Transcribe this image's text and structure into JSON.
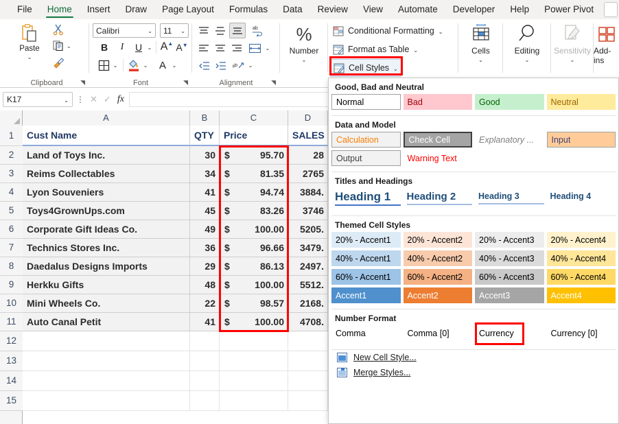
{
  "ribbon_tabs": [
    {
      "label": "File",
      "active": false
    },
    {
      "label": "Home",
      "active": true
    },
    {
      "label": "Insert",
      "active": false
    },
    {
      "label": "Draw",
      "active": false
    },
    {
      "label": "Page Layout",
      "active": false
    },
    {
      "label": "Formulas",
      "active": false
    },
    {
      "label": "Data",
      "active": false
    },
    {
      "label": "Review",
      "active": false
    },
    {
      "label": "View",
      "active": false
    },
    {
      "label": "Automate",
      "active": false
    },
    {
      "label": "Developer",
      "active": false
    },
    {
      "label": "Help",
      "active": false
    },
    {
      "label": "Power Pivot",
      "active": false
    }
  ],
  "ribbon": {
    "clipboard": {
      "group_label": "Clipboard",
      "paste_label": "Paste",
      "cut_name": "cut-icon",
      "copy_name": "copy-icon",
      "format_painter_name": "format-painter-icon"
    },
    "font": {
      "group_label": "Font",
      "font_name": "Calibri",
      "font_size": "11",
      "bold": "B",
      "italic": "I",
      "underline": "U",
      "grow_font": "A",
      "shrink_font": "A",
      "borders_name": "borders-icon",
      "fill_color_name": "fill-color-icon",
      "font_color_name": "font-color-icon"
    },
    "alignment": {
      "group_label": "Alignment",
      "wrap_text_name": "wrap-text-icon",
      "merge_center_name": "merge-and-center-icon",
      "orientation_name": "orientation-icon",
      "decrease_indent_name": "decrease-indent-icon",
      "increase_indent_name": "increase-indent-icon"
    },
    "number": {
      "group_label": "Number",
      "label": "Number",
      "symbol": "%"
    },
    "styles": {
      "conditional_formatting": "Conditional Formatting",
      "format_as_table": "Format as Table",
      "cell_styles": "Cell Styles",
      "chevron": "⌄"
    },
    "cells": {
      "label": "Cells"
    },
    "editing": {
      "label": "Editing"
    },
    "sensitivity": {
      "label": "Sensitivity"
    },
    "addins": {
      "label": "Add-ins"
    }
  },
  "formula_bar": {
    "name_box": "K17",
    "formula_value": "",
    "cancel_icon": "cancel-icon",
    "confirm_icon": "confirm-icon",
    "fx_label": "fx"
  },
  "sheet": {
    "column_headers": [
      "A",
      "B",
      "C",
      "D"
    ],
    "row_numbers": [
      "1",
      "2",
      "3",
      "4",
      "5",
      "6",
      "7",
      "8",
      "9",
      "10",
      "11",
      "12",
      "13",
      "14",
      "15"
    ],
    "headers": {
      "a": "Cust Name",
      "b": "QTY",
      "c": "Price",
      "d": "SALES"
    },
    "rows": [
      {
        "row": "2",
        "name": "Land of Toys Inc.",
        "qty": "30",
        "price_sym": "$",
        "price": "95.70",
        "sales": "28"
      },
      {
        "row": "3",
        "name": "Reims Collectables",
        "qty": "34",
        "price_sym": "$",
        "price": "81.35",
        "sales": "2765"
      },
      {
        "row": "4",
        "name": "Lyon Souveniers",
        "qty": "41",
        "price_sym": "$",
        "price": "94.74",
        "sales": "3884."
      },
      {
        "row": "5",
        "name": "Toys4GrownUps.com",
        "qty": "45",
        "price_sym": "$",
        "price": "83.26",
        "sales": "3746"
      },
      {
        "row": "6",
        "name": "Corporate Gift Ideas Co.",
        "qty": "49",
        "price_sym": "$",
        "price": "100.00",
        "sales": "5205."
      },
      {
        "row": "7",
        "name": "Technics Stores Inc.",
        "qty": "36",
        "price_sym": "$",
        "price": "96.66",
        "sales": "3479."
      },
      {
        "row": "8",
        "name": "Daedalus Designs Imports",
        "qty": "29",
        "price_sym": "$",
        "price": "86.13",
        "sales": "2497."
      },
      {
        "row": "9",
        "name": "Herkku Gifts",
        "qty": "48",
        "price_sym": "$",
        "price": "100.00",
        "sales": "5512."
      },
      {
        "row": "10",
        "name": "Mini Wheels Co.",
        "qty": "22",
        "price_sym": "$",
        "price": "98.57",
        "sales": "2168."
      },
      {
        "row": "11",
        "name": "Auto Canal Petit",
        "qty": "41",
        "price_sym": "$",
        "price": "100.00",
        "sales": "4708."
      }
    ],
    "empty_rows": [
      "12",
      "13",
      "14",
      "15"
    ]
  },
  "cell_styles_gallery": {
    "sections": [
      {
        "title": "Good, Bad and Neutral",
        "items": [
          {
            "label": "Normal",
            "bg": "#ffffff",
            "fg": "#000000",
            "border": true
          },
          {
            "label": "Bad",
            "bg": "#ffc7ce",
            "fg": "#9c0006",
            "border": false
          },
          {
            "label": "Good",
            "bg": "#c6efce",
            "fg": "#006100",
            "border": false
          },
          {
            "label": "Neutral",
            "bg": "#ffeb9c",
            "fg": "#9c6500",
            "border": false
          }
        ]
      },
      {
        "title": "Data and Model",
        "items": [
          {
            "label": "Calculation",
            "bg": "#f2f2f2",
            "fg": "#fa7d00",
            "border": true
          },
          {
            "label": "Check Cell",
            "bg": "#a5a5a5",
            "fg": "#ffffff",
            "border": true
          },
          {
            "label": "Explanatory ...",
            "bg": "transparent",
            "fg": "#7f7f7f",
            "border": false
          },
          {
            "label": "Input",
            "bg": "#ffcc99",
            "fg": "#3f3f76",
            "border": true
          },
          {
            "label": "Output",
            "bg": "#f2f2f2",
            "fg": "#3f3f3f",
            "border": true
          },
          {
            "label": "Warning Text",
            "bg": "transparent",
            "fg": "#ff0000",
            "border": false
          }
        ]
      },
      {
        "title": "Titles and Headings",
        "items": [
          {
            "label": "Heading 1",
            "fg": "#1f4e79",
            "underline": "#4472c4",
            "size": "17px"
          },
          {
            "label": "Heading 2",
            "fg": "#1f4e79",
            "underline": "#a6bce3",
            "size": "15px"
          },
          {
            "label": "Heading 3",
            "fg": "#1f4e79",
            "underline": "#a6bce3",
            "size": "12.5px"
          },
          {
            "label": "Heading 4",
            "fg": "#1f4e79",
            "underline": "transparent",
            "size": "12.5px"
          }
        ]
      },
      {
        "title": "Themed Cell Styles",
        "items": [
          {
            "label": "20% - Accent1",
            "bg": "#ddebf7",
            "fg": "#000000"
          },
          {
            "label": "20% - Accent2",
            "bg": "#fce4d6",
            "fg": "#000000"
          },
          {
            "label": "20% - Accent3",
            "bg": "#ededed",
            "fg": "#000000"
          },
          {
            "label": "20% - Accent4",
            "bg": "#fff2cc",
            "fg": "#000000"
          },
          {
            "label": "40% - Accent1",
            "bg": "#bdd7ee",
            "fg": "#000000"
          },
          {
            "label": "40% - Accent2",
            "bg": "#f8cbad",
            "fg": "#000000"
          },
          {
            "label": "40% - Accent3",
            "bg": "#dbdbdb",
            "fg": "#000000"
          },
          {
            "label": "40% - Accent4",
            "bg": "#ffe699",
            "fg": "#000000"
          },
          {
            "label": "60% - Accent1",
            "bg": "#9dc3e6",
            "fg": "#000000"
          },
          {
            "label": "60% - Accent2",
            "bg": "#f4b183",
            "fg": "#000000"
          },
          {
            "label": "60% - Accent3",
            "bg": "#c9c9c9",
            "fg": "#000000"
          },
          {
            "label": "60% - Accent4",
            "bg": "#ffd966",
            "fg": "#000000"
          },
          {
            "label": "Accent1",
            "bg": "#4f90cd",
            "fg": "#ffffff"
          },
          {
            "label": "Accent2",
            "bg": "#ed7d31",
            "fg": "#ffffff"
          },
          {
            "label": "Accent3",
            "bg": "#a5a5a5",
            "fg": "#ffffff"
          },
          {
            "label": "Accent4",
            "bg": "#ffc000",
            "fg": "#ffffff"
          }
        ]
      },
      {
        "title": "Number Format",
        "items": [
          {
            "label": "Comma",
            "bg": "transparent",
            "fg": "#000000"
          },
          {
            "label": "Comma [0]",
            "bg": "transparent",
            "fg": "#000000"
          },
          {
            "label": "Currency",
            "bg": "transparent",
            "fg": "#000000",
            "highlighted": true
          },
          {
            "label": "Currency [0]",
            "bg": "transparent",
            "fg": "#000000"
          }
        ]
      }
    ],
    "commands": [
      {
        "label": "New Cell Style...",
        "icon": "new-cell-style-icon"
      },
      {
        "label": "Merge Styles...",
        "icon": "merge-styles-icon"
      }
    ]
  },
  "colors": {
    "accent_green": "#107c41",
    "highlight_red": "#ff0000",
    "ribbon_bg": "#f3f2f1"
  }
}
